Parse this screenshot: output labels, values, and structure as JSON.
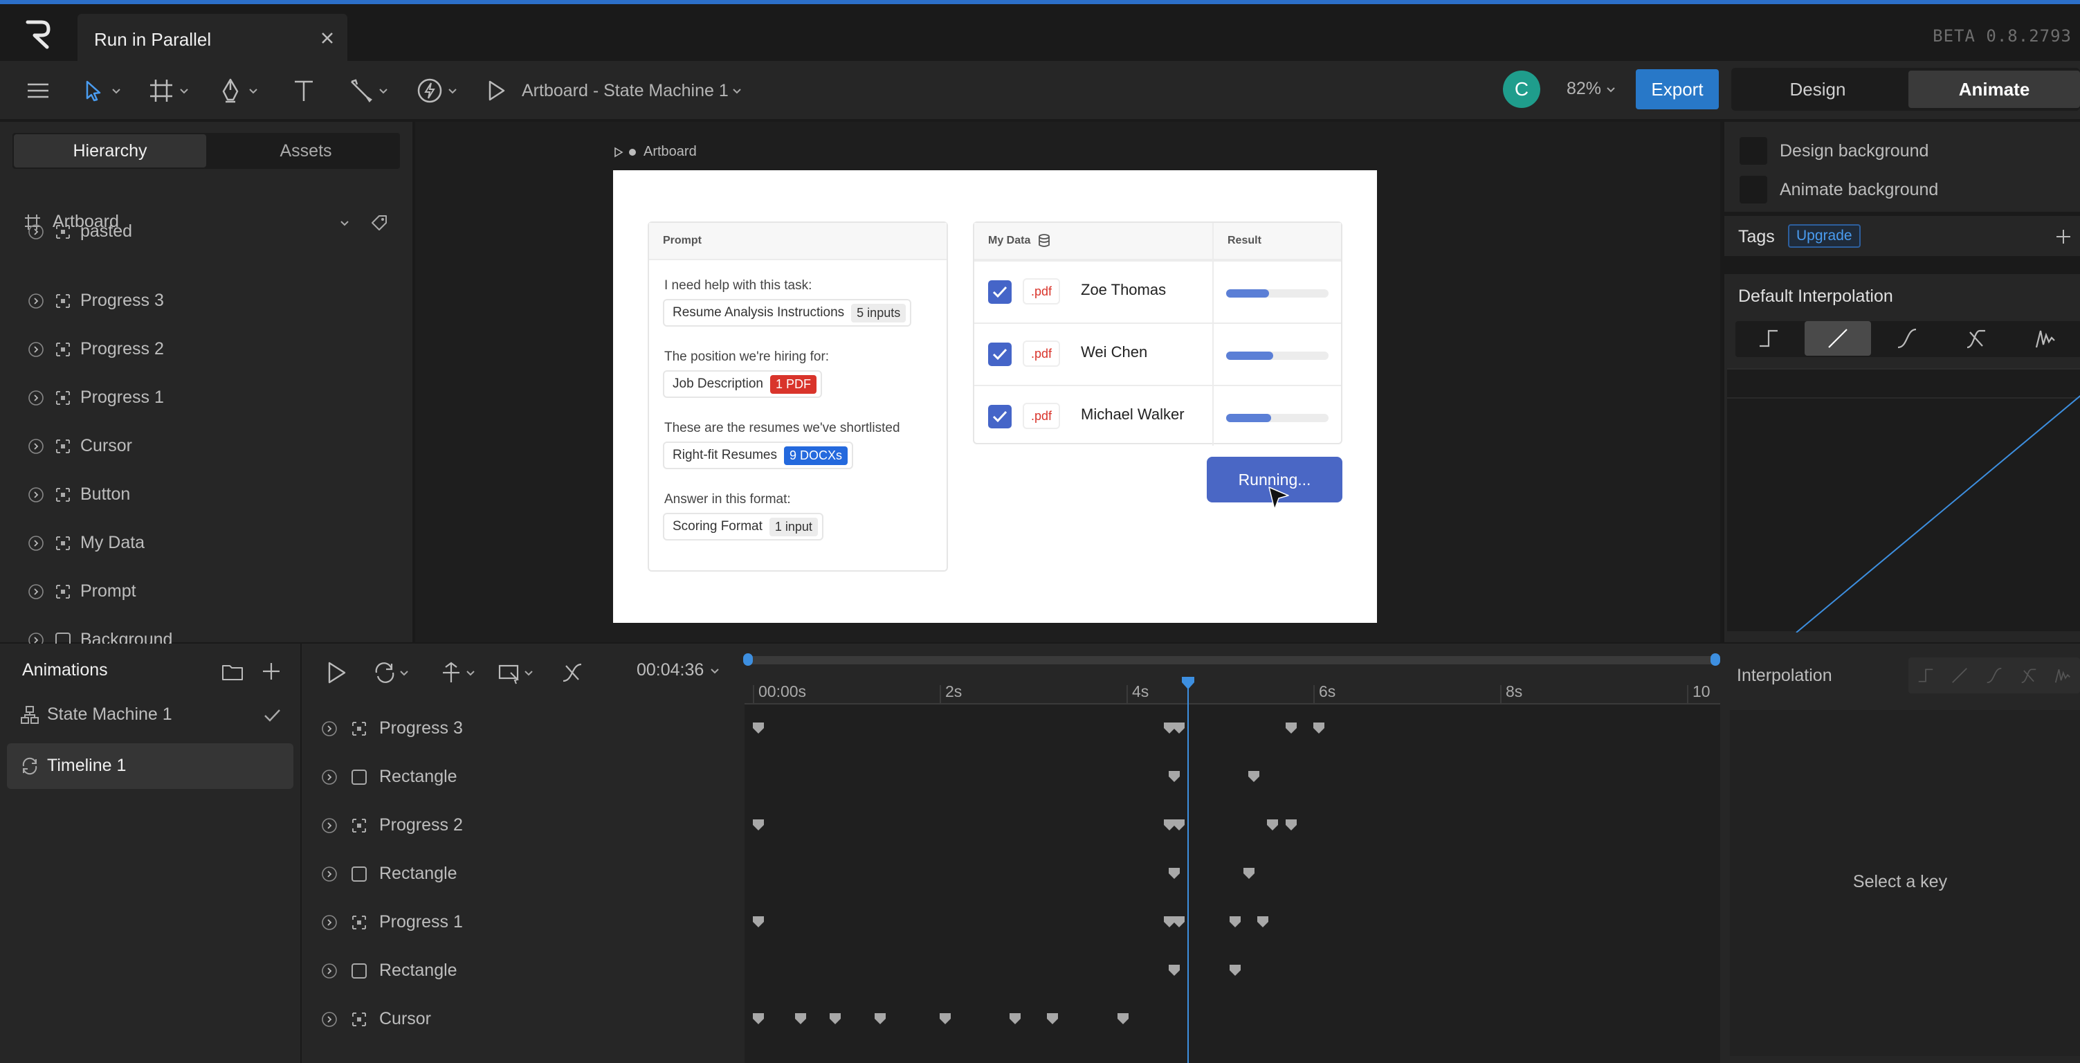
{
  "window": {
    "tab_title": "Run in Parallel",
    "version": "BETA 0.8.2793"
  },
  "toolbar": {
    "breadcrumb": "Artboard - State Machine 1",
    "avatar_initial": "C",
    "zoom": "82%",
    "export_label": "Export",
    "mode_design": "Design",
    "mode_animate": "Animate",
    "icons": [
      "menu-icon",
      "select-tool-icon",
      "frame-tool-icon",
      "pen-tool-icon",
      "text-tool-icon",
      "bone-tool-icon",
      "lightning-icon",
      "play-icon"
    ]
  },
  "hierarchy": {
    "tab_hierarchy": "Hierarchy",
    "tab_assets": "Assets",
    "root": "Artboard",
    "items": [
      {
        "label": "pasted",
        "kind": "group"
      },
      {
        "label": "Progress 3",
        "kind": "group"
      },
      {
        "label": "Progress 2",
        "kind": "group"
      },
      {
        "label": "Progress 1",
        "kind": "group"
      },
      {
        "label": "Cursor",
        "kind": "group"
      },
      {
        "label": "Button",
        "kind": "group"
      },
      {
        "label": "My Data",
        "kind": "group"
      },
      {
        "label": "Prompt",
        "kind": "group"
      },
      {
        "label": "Background",
        "kind": "shape"
      }
    ]
  },
  "artboard": {
    "label": "Artboard",
    "prompt": {
      "header": "Prompt",
      "lines": [
        {
          "text": "I need help with this task:",
          "chip": "Resume Analysis Instructions",
          "badge": "5 inputs",
          "badge_style": "grey"
        },
        {
          "text": "The position we're hiring for:",
          "chip": "Job Description",
          "badge": "1 PDF",
          "badge_style": "red"
        },
        {
          "text": "These are the resumes we've shortlisted",
          "chip": "Right-fit Resumes",
          "badge": "9 DOCXs",
          "badge_style": "blue"
        },
        {
          "text": "Answer in this format:",
          "chip": "Scoring Format",
          "badge": "1 input",
          "badge_style": "grey"
        }
      ]
    },
    "data_table": {
      "col_data": "My Data",
      "col_result": "Result",
      "rows": [
        {
          "tag": ".pdf",
          "name": "Zoe Thomas",
          "progress": 0.42
        },
        {
          "tag": ".pdf",
          "name": "Wei Chen",
          "progress": 0.46
        },
        {
          "tag": ".pdf",
          "name": "Michael Walker",
          "progress": 0.44
        }
      ]
    },
    "button": "Running..."
  },
  "inspector": {
    "design_background": "Design background",
    "animate_background": "Animate background",
    "tags": "Tags",
    "upgrade": "Upgrade",
    "default_interpolation": "Default Interpolation",
    "interp_selected": "linear",
    "interp_options": [
      "hold",
      "linear",
      "cubic",
      "elastic",
      "spring"
    ]
  },
  "animations": {
    "title": "Animations",
    "items": [
      {
        "label": "State Machine 1",
        "kind": "state-machine",
        "checked": true
      },
      {
        "label": "Timeline 1",
        "kind": "timeline",
        "selected": true
      }
    ]
  },
  "timeline": {
    "time": "00:04:36",
    "ruler": [
      "00:00s",
      "2s",
      "4s",
      "6s",
      "8s",
      "10"
    ],
    "playhead_seconds": 4.6,
    "tracks": [
      {
        "label": "Progress 3",
        "kind": "group",
        "keys": [
          0.0,
          4.4,
          4.5,
          5.7,
          6.0
        ]
      },
      {
        "label": "Rectangle",
        "kind": "shape",
        "keys": [
          4.45,
          5.3
        ]
      },
      {
        "label": "Progress 2",
        "kind": "group",
        "keys": [
          0.0,
          4.4,
          4.5,
          5.5,
          5.7
        ]
      },
      {
        "label": "Rectangle",
        "kind": "shape",
        "keys": [
          4.45,
          5.25
        ]
      },
      {
        "label": "Progress 1",
        "kind": "group",
        "keys": [
          0.0,
          4.4,
          4.5,
          5.1,
          5.4
        ]
      },
      {
        "label": "Rectangle",
        "kind": "shape",
        "keys": [
          4.45,
          5.1
        ]
      },
      {
        "label": "Cursor",
        "kind": "group",
        "keys": [
          0.0,
          0.45,
          0.82,
          1.3,
          2.0,
          2.75,
          3.15,
          3.9
        ]
      }
    ]
  },
  "interpolation_panel": {
    "title": "Interpolation",
    "empty": "Select a key"
  }
}
